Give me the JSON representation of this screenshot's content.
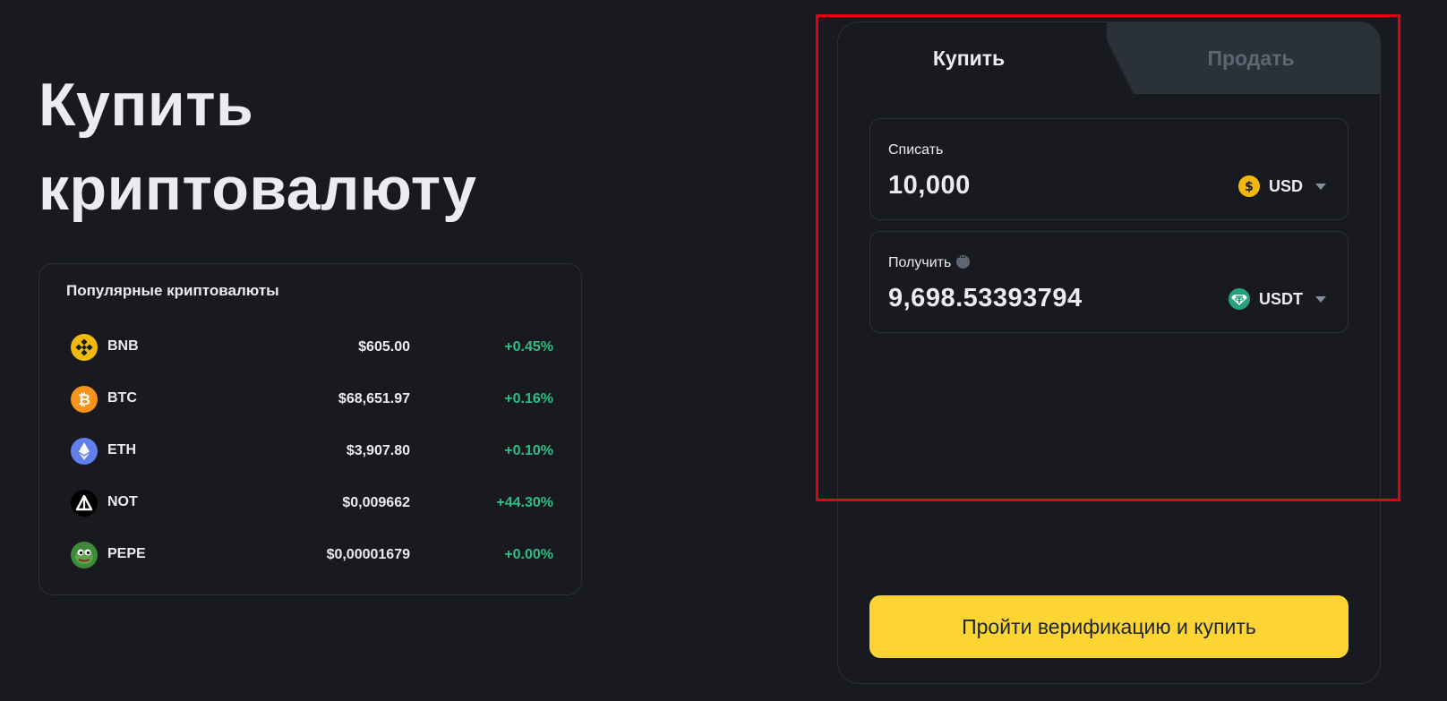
{
  "hero": {
    "title_line1": "Купить",
    "title_line2": "криптовалюту"
  },
  "popular": {
    "title": "Популярные криптовалюты",
    "coins": [
      {
        "symbol": "BNB",
        "price": "$605.00",
        "change": "+0.45%",
        "icon": "bnb-icon",
        "color": "#f0b90b"
      },
      {
        "symbol": "BTC",
        "price": "$68,651.97",
        "change": "+0.16%",
        "icon": "btc-icon",
        "color": "#f7931a"
      },
      {
        "symbol": "ETH",
        "price": "$3,907.80",
        "change": "+0.10%",
        "icon": "eth-icon",
        "color": "#627eea"
      },
      {
        "symbol": "NOT",
        "price": "$0,009662",
        "change": "+44.30%",
        "icon": "not-icon",
        "color": "#000000"
      },
      {
        "symbol": "PEPE",
        "price": "$0,00001679",
        "change": "+0.00%",
        "icon": "pepe-icon",
        "color": "#3d8a3a"
      }
    ]
  },
  "trade": {
    "tabs": {
      "buy": "Купить",
      "sell": "Продать"
    },
    "active_tab": "buy",
    "spend": {
      "label": "Списать",
      "value": "10,000",
      "currency": "USD",
      "icon": "usd-icon"
    },
    "receive": {
      "label": "Получить",
      "value": "9,698.53393794",
      "currency": "USDT",
      "icon": "usdt-icon"
    },
    "cta_label": "Пройти верификацию и купить"
  },
  "colors": {
    "background": "#181a20",
    "border": "#2b3139",
    "positive": "#2ebd85",
    "accent": "#fcd535",
    "highlight": "#e0000f"
  }
}
